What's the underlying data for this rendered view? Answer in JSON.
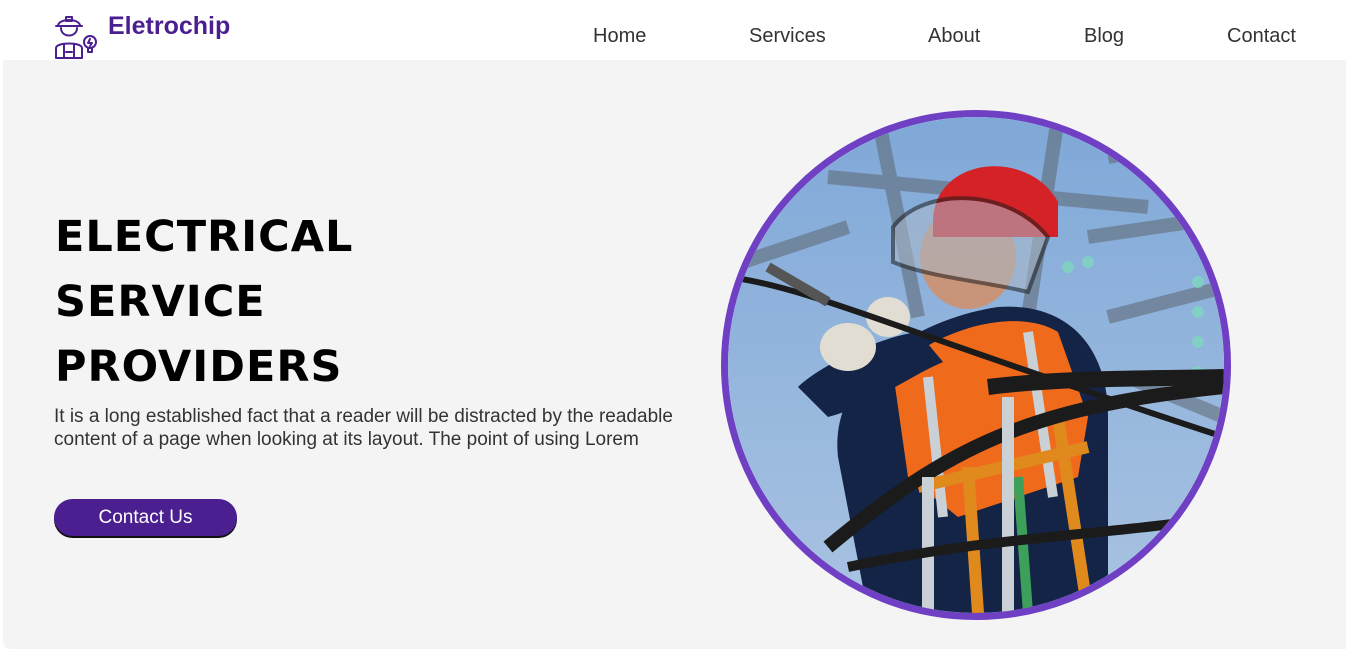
{
  "brand": {
    "name": "Eletrochip",
    "icon": "electrician-worker-icon",
    "color": "#4b1f8f"
  },
  "nav": {
    "items": [
      {
        "label": "Home"
      },
      {
        "label": "Services"
      },
      {
        "label": "About"
      },
      {
        "label": "Blog"
      },
      {
        "label": "Contact"
      }
    ]
  },
  "hero": {
    "title_lines": [
      "ELECTRICAL",
      "SERVICE",
      "PROVIDERS"
    ],
    "description": "It is a long established fact that a reader will be distracted by the readable content of a page when looking at its layout. The point of using Lorem",
    "cta_label": "Contact Us",
    "image": "electrician-at-work-photo",
    "accent": "#6f3fc4"
  }
}
